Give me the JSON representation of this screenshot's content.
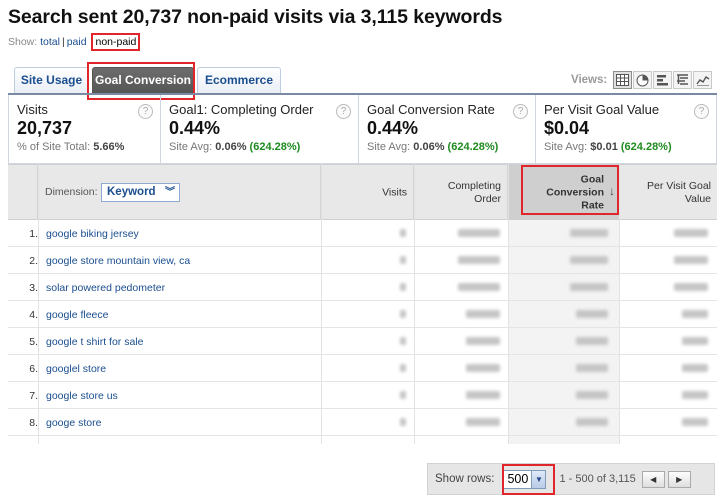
{
  "header": {
    "title": "Search sent 20,737 non-paid visits via 3,115 keywords"
  },
  "show_filter": {
    "label": "Show:",
    "total": "total",
    "separator": "|",
    "paid": "paid",
    "non_paid": "non-paid",
    "active": "non-paid"
  },
  "tabs": [
    {
      "label": "Site Usage",
      "active": false
    },
    {
      "label": "Goal Conversion",
      "active": true
    },
    {
      "label": "Ecommerce",
      "active": false
    }
  ],
  "views": {
    "label": "Views:",
    "options": [
      "table-icon",
      "pie-icon",
      "comparison-icon",
      "pivot-icon",
      "trend-icon"
    ],
    "active": "table-icon"
  },
  "scorecards": [
    {
      "name": "Visits",
      "value": "20,737",
      "sub_label": "% of Site Total:",
      "sub_value": "5.66%",
      "sub_extra": ""
    },
    {
      "name": "Goal1: Completing Order",
      "value": "0.44%",
      "sub_label": "Site Avg:",
      "sub_value": "0.06%",
      "sub_extra": "(624.28%)"
    },
    {
      "name": "Goal Conversion Rate",
      "value": "0.44%",
      "sub_label": "Site Avg:",
      "sub_value": "0.06%",
      "sub_extra": "(624.28%)"
    },
    {
      "name": "Per Visit Goal Value",
      "value": "$0.04",
      "sub_label": "Site Avg:",
      "sub_value": "$0.01",
      "sub_extra": "(624.28%)"
    }
  ],
  "table": {
    "dimension_label": "Dimension:",
    "dimension_value": "Keyword",
    "columns": {
      "visits": "Visits",
      "completing_order_1": "Completing",
      "completing_order_2": "Order",
      "conversion_rate_1": "Goal",
      "conversion_rate_2": "Conversion",
      "conversion_rate_3": "Rate",
      "per_visit_1": "Per Visit Goal",
      "per_visit_2": "Value"
    },
    "sort_arrow": "↓",
    "rows": [
      {
        "num": "1.",
        "keyword": "google biking jersey"
      },
      {
        "num": "2.",
        "keyword": "google store mountain view, ca"
      },
      {
        "num": "3.",
        "keyword": "solar powered pedometer"
      },
      {
        "num": "4.",
        "keyword": "google fleece"
      },
      {
        "num": "5.",
        "keyword": "google t shirt for sale"
      },
      {
        "num": "6.",
        "keyword": "googlel store"
      },
      {
        "num": "7.",
        "keyword": "google store us"
      },
      {
        "num": "8.",
        "keyword": "googe store"
      }
    ]
  },
  "pager": {
    "show_rows_label": "Show rows:",
    "rows_value": "500",
    "range": "1 - 500 of 3,115",
    "prev": "◀",
    "next": "▶"
  },
  "colors": {
    "accent_link": "#1a4e8f",
    "highlight_red": "#e0262b",
    "positive_green": "#1f8a1f"
  }
}
